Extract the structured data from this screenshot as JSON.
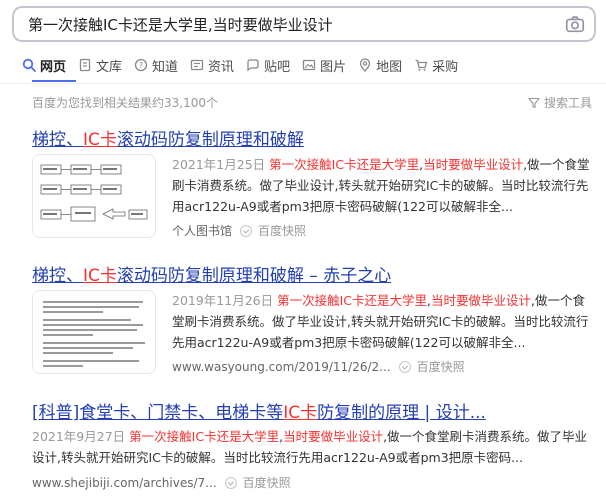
{
  "search": {
    "query": "第一次接触IC卡还是大学里,当时要做毕业设计"
  },
  "tabs": [
    {
      "label": "网页",
      "icon": "search-icon"
    },
    {
      "label": "文库",
      "icon": "document-icon"
    },
    {
      "label": "知道",
      "icon": "question-icon"
    },
    {
      "label": "资讯",
      "icon": "news-icon"
    },
    {
      "label": "贴吧",
      "icon": "tieba-icon"
    },
    {
      "label": "图片",
      "icon": "image-icon"
    },
    {
      "label": "地图",
      "icon": "map-icon"
    },
    {
      "label": "采购",
      "icon": "cart-icon"
    }
  ],
  "result_count": "百度为您找到相关结果约33,100个",
  "search_tools": "搜索工具",
  "colors": {
    "link": "#2440b3",
    "highlight": "#f73131",
    "accent": "#4e6ef2"
  },
  "results": [
    {
      "title_pre": "梯控、",
      "title_hl": "IC卡",
      "title_post": "滚动码防复制原理和破解",
      "date": "2021年1月25日",
      "hl1": "第一次接触IC卡还是大学里",
      "sep": ",",
      "hl2": "当时要做毕业设计",
      "abstract": ",做一个食堂刷卡消费系统。做了毕业设计,转头就开始研究IC卡的破解。当时比较流行先用acr122u-A9或者pm3把原卡密码破解(122可以破解非全...",
      "source": "个人图书馆",
      "snapshot": "百度快照"
    },
    {
      "title_pre": "梯控、",
      "title_hl": "IC卡",
      "title_post": "滚动码防复制原理和破解 – 赤子之心",
      "date": "2019年11月26日",
      "hl1": "第一次接触IC卡还是大学里",
      "sep": ",",
      "hl2": "当时要做毕业设计",
      "abstract": ",做一个食堂刷卡消费系统。做了毕业设计,转头就开始研究IC卡的破解。当时比较流行先用acr122u-A9或者pm3把原卡密码破解(122可以破解非全...",
      "source": "www.wasyoung.com/2019/11/26/2...",
      "snapshot": "百度快照"
    },
    {
      "title_pre": "[科普]食堂卡、门禁卡、电梯卡等",
      "title_hl": "IC卡",
      "title_post": "防复制的原理 | 设计...",
      "date": "2021年9月27日",
      "hl1": "第一次接触IC卡还是大学里",
      "sep": ",",
      "hl2": "当时要做毕业设计",
      "abstract": ",做一个食堂刷卡消费系统。做了毕业设计,转头就开始研究IC卡的破解。当时比较流行先用acr122u-A9或者pm3把原卡密码...",
      "source": "www.shejibiji.com/archives/7...",
      "snapshot": "百度快照"
    }
  ]
}
